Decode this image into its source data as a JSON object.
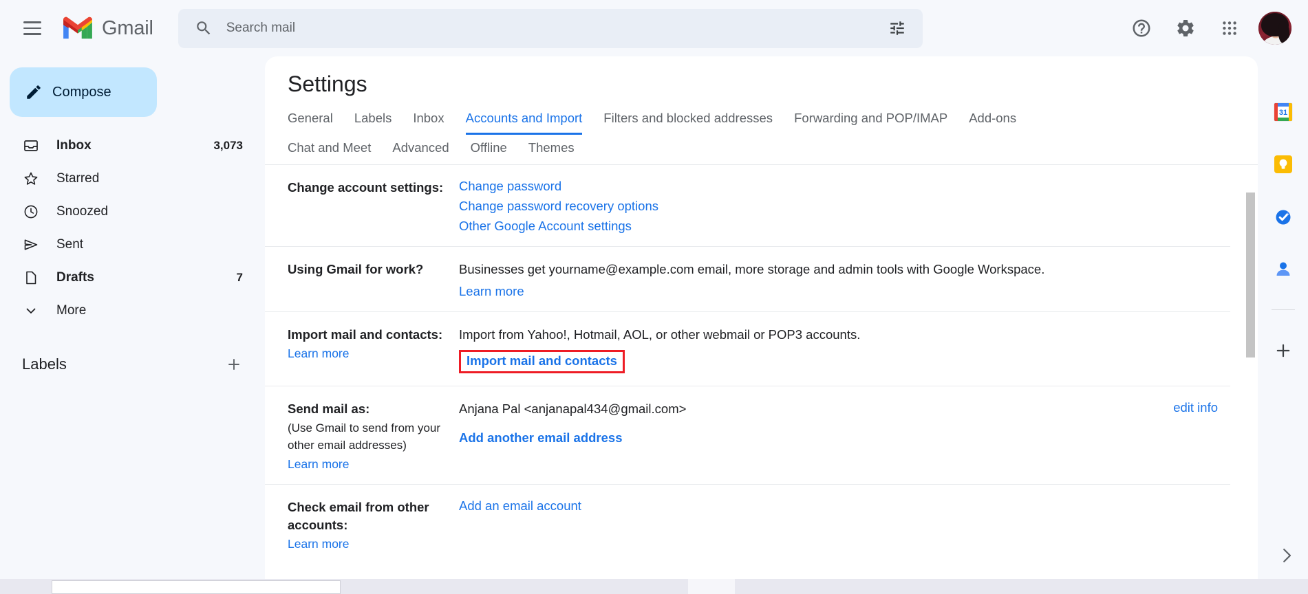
{
  "header": {
    "menu_icon": "hamburger-icon",
    "brand": "Gmail",
    "search": {
      "placeholder": "Search mail",
      "value": "",
      "search_icon": "search-icon",
      "filter_icon": "tune-icon"
    },
    "help_icon": "help-icon",
    "settings_icon": "gear-icon",
    "apps_icon": "apps-grid-icon",
    "avatar": "user-avatar"
  },
  "sidebar": {
    "compose": "Compose",
    "items": [
      {
        "label": "Inbox",
        "count": "3,073",
        "icon": "inbox-icon",
        "bold": true
      },
      {
        "label": "Starred",
        "count": "",
        "icon": "star-icon",
        "bold": false
      },
      {
        "label": "Snoozed",
        "count": "",
        "icon": "clock-icon",
        "bold": false
      },
      {
        "label": "Sent",
        "count": "",
        "icon": "send-icon",
        "bold": false
      },
      {
        "label": "Drafts",
        "count": "7",
        "icon": "draft-icon",
        "bold": true
      },
      {
        "label": "More",
        "count": "",
        "icon": "chevron-down-icon",
        "bold": false
      }
    ],
    "labels_title": "Labels",
    "labels_add_icon": "plus-icon"
  },
  "main": {
    "title": "Settings",
    "tabs_row1": [
      {
        "label": "General",
        "active": false
      },
      {
        "label": "Labels",
        "active": false
      },
      {
        "label": "Inbox",
        "active": false
      },
      {
        "label": "Accounts and Import",
        "active": true
      },
      {
        "label": "Filters and blocked addresses",
        "active": false
      },
      {
        "label": "Forwarding and POP/IMAP",
        "active": false
      },
      {
        "label": "Add-ons",
        "active": false
      }
    ],
    "tabs_row2": [
      {
        "label": "Chat and Meet",
        "active": false
      },
      {
        "label": "Advanced",
        "active": false
      },
      {
        "label": "Offline",
        "active": false
      },
      {
        "label": "Themes",
        "active": false
      }
    ],
    "sections": {
      "change_account": {
        "title": "Change account settings:",
        "links": [
          "Change password",
          "Change password recovery options",
          "Other Google Account settings"
        ]
      },
      "gmail_for_work": {
        "title": "Using Gmail for work?",
        "text": "Businesses get yourname@example.com email, more storage and admin tools with Google Workspace.",
        "learn_more": "Learn more"
      },
      "import_mail": {
        "title": "Import mail and contacts:",
        "learn_more": "Learn more",
        "text": "Import from Yahoo!, Hotmail, AOL, or other webmail or POP3 accounts.",
        "action_link": "Import mail and contacts",
        "highlight_color": "#ee1c25"
      },
      "send_mail_as": {
        "title": "Send mail as:",
        "subtitle": "(Use Gmail to send from your other email addresses)",
        "learn_more": "Learn more",
        "account": "Anjana Pal <anjanapal434@gmail.com>",
        "edit_info": "edit info",
        "add_link": "Add another email address"
      },
      "check_email": {
        "title": "Check email from other accounts:",
        "learn_more": "Learn more",
        "add_link": "Add an email account"
      }
    }
  },
  "rail": {
    "items": [
      {
        "icon": "google-calendar-icon",
        "label": "Calendar"
      },
      {
        "icon": "google-keep-icon",
        "label": "Keep"
      },
      {
        "icon": "google-tasks-icon",
        "label": "Tasks"
      },
      {
        "icon": "google-contacts-icon",
        "label": "Contacts"
      }
    ],
    "add_icon": "plus-icon",
    "expand_icon": "chevron-right-icon"
  }
}
